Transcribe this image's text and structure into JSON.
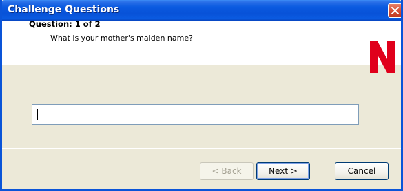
{
  "window": {
    "title": "Challenge Questions"
  },
  "header": {
    "question_title": "Question:  1 of 2",
    "question_text": "What is your mother's maiden name?",
    "logo_letter": "N",
    "logo_color": "#e0001b"
  },
  "form": {
    "answer_value": "",
    "answer_placeholder": ""
  },
  "buttons": {
    "back_label": "< Back",
    "next_label": "Next >",
    "cancel_label": "Cancel"
  },
  "icons": {
    "close": "close-icon",
    "logo": "novell-n-logo"
  },
  "colors": {
    "titlebar": "#0a5ae0",
    "face": "#ece9d8",
    "close_button": "#d9533a"
  }
}
